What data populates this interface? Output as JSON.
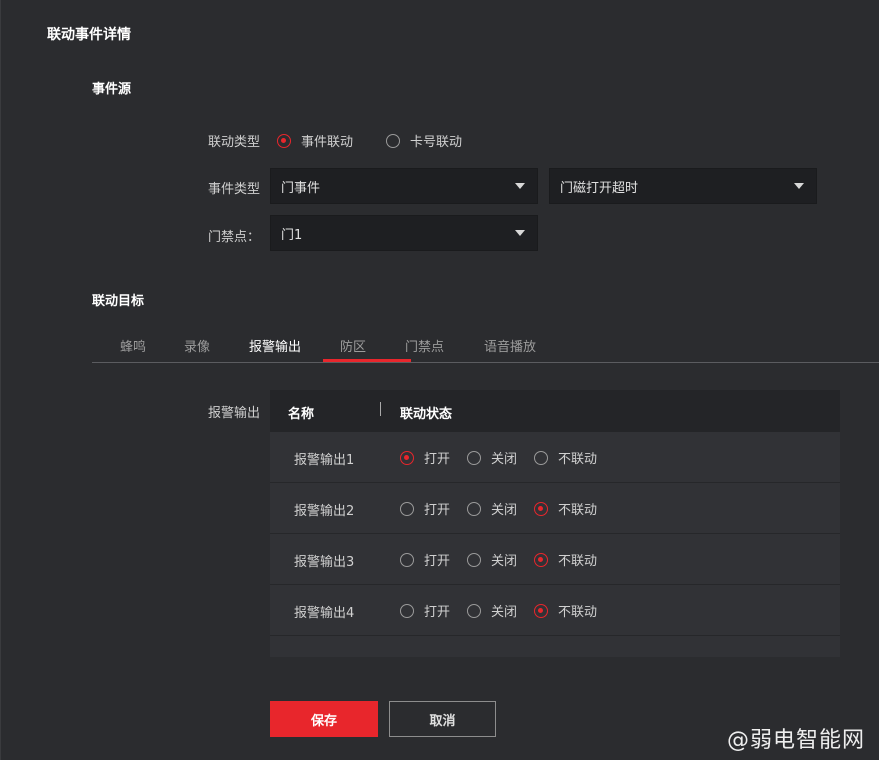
{
  "page_title": "联动事件详情",
  "event_source": {
    "section_title": "事件源",
    "linkage_type": {
      "label": "联动类型",
      "options": [
        {
          "label": "事件联动",
          "checked": true
        },
        {
          "label": "卡号联动",
          "checked": false
        }
      ]
    },
    "event_type": {
      "label": "事件类型",
      "primary": "门事件",
      "secondary": "门磁打开超时"
    },
    "door_point": {
      "label": "门禁点：",
      "value": "门1"
    }
  },
  "linkage_target": {
    "section_title": "联动目标",
    "tabs": [
      {
        "label": "蜂鸣",
        "active": false
      },
      {
        "label": "录像",
        "active": false
      },
      {
        "label": "报警输出",
        "active": true
      },
      {
        "label": "防区",
        "active": false
      },
      {
        "label": "门禁点",
        "active": false
      },
      {
        "label": "语音播放",
        "active": false
      }
    ],
    "alarm_output": {
      "label": "报警输出",
      "columns": {
        "name": "名称",
        "status": "联动状态"
      },
      "option_labels": [
        "打开",
        "关闭",
        "不联动"
      ],
      "rows": [
        {
          "name": "报警输出1",
          "selected": "打开"
        },
        {
          "name": "报警输出2",
          "selected": "不联动"
        },
        {
          "name": "报警输出3",
          "selected": "不联动"
        },
        {
          "name": "报警输出4",
          "selected": "不联动"
        }
      ]
    }
  },
  "buttons": {
    "save": "保存",
    "cancel": "取消"
  },
  "watermark": "@弱电智能网",
  "colors": {
    "accent": "#e8262c",
    "background": "#2b2c2f",
    "input_bg": "#1e1f22"
  },
  "icons": {
    "select_caret": "caret-down-icon",
    "radio": "radio-icon"
  }
}
